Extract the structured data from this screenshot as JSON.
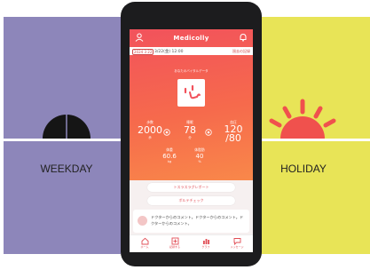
{
  "weekday": {
    "label": "WEEKDAY"
  },
  "holiday": {
    "label": "HOLIDAY"
  },
  "app": {
    "title": "Medicolly",
    "date_badge": "2024 3 22",
    "date": "3/22(金) 12:00",
    "history_link": "過去の記録",
    "caption": "あなたのバイタルデータ",
    "stats": [
      {
        "label": "歩数",
        "value": "2000",
        "unit": "歩"
      },
      {
        "label": "睡眠",
        "value": "78",
        "unit": "分"
      },
      {
        "label": "血圧",
        "value": "120\n/80",
        "unit": "mmHg"
      }
    ],
    "mini": [
      {
        "label": "体重",
        "value": "60.6",
        "unit": "kg"
      },
      {
        "label": "体脂肪",
        "value": "40",
        "unit": "%"
      }
    ],
    "buttons": [
      "トスラスラグレポート",
      "ボルテチェック"
    ],
    "message": "ドクターからのコメント。ドクターからのコメント。ドクターからのコメント。",
    "tabs": [
      "ホーム",
      "記録する",
      "グラフ",
      "メッセージ"
    ]
  },
  "colors": {
    "weekday_bg": "#8d86ba",
    "holiday_bg": "#e8e457",
    "accent": "#f2525c",
    "sun": "#f0514d"
  }
}
